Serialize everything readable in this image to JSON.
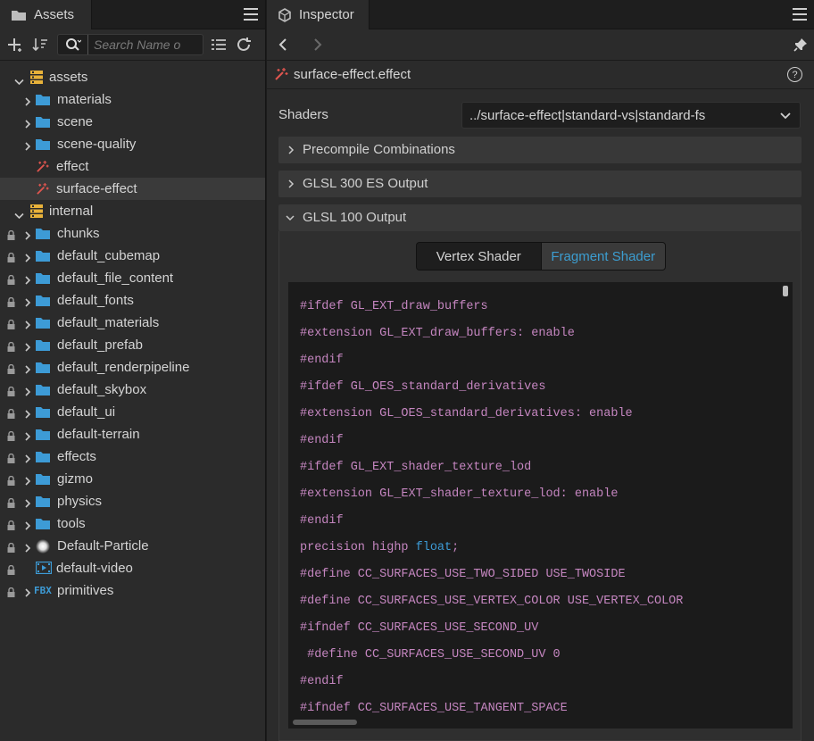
{
  "assets": {
    "tab_label": "Assets",
    "search_placeholder": "Search Name o",
    "tree": [
      {
        "label": "assets",
        "depth": 0,
        "expanded": true,
        "icon": "db-icon",
        "lock": false
      },
      {
        "label": "materials",
        "depth": 1,
        "expanded": false,
        "icon": "folder-icon",
        "lock": false
      },
      {
        "label": "scene",
        "depth": 1,
        "expanded": false,
        "icon": "folder-icon",
        "lock": false
      },
      {
        "label": "scene-quality",
        "depth": 1,
        "expanded": false,
        "icon": "folder-icon",
        "lock": false
      },
      {
        "label": "effect",
        "depth": 1,
        "expanded": null,
        "icon": "effect-icon",
        "lock": false
      },
      {
        "label": "surface-effect",
        "depth": 1,
        "expanded": null,
        "icon": "effect-icon",
        "lock": false,
        "selected": true
      },
      {
        "label": "internal",
        "depth": 0,
        "expanded": true,
        "icon": "db-icon",
        "lock": false
      },
      {
        "label": "chunks",
        "depth": 1,
        "expanded": false,
        "icon": "folder-icon",
        "lock": true
      },
      {
        "label": "default_cubemap",
        "depth": 1,
        "expanded": false,
        "icon": "folder-icon",
        "lock": true
      },
      {
        "label": "default_file_content",
        "depth": 1,
        "expanded": false,
        "icon": "folder-icon",
        "lock": true
      },
      {
        "label": "default_fonts",
        "depth": 1,
        "expanded": false,
        "icon": "folder-icon",
        "lock": true
      },
      {
        "label": "default_materials",
        "depth": 1,
        "expanded": false,
        "icon": "folder-icon",
        "lock": true
      },
      {
        "label": "default_prefab",
        "depth": 1,
        "expanded": false,
        "icon": "folder-icon",
        "lock": true
      },
      {
        "label": "default_renderpipeline",
        "depth": 1,
        "expanded": false,
        "icon": "folder-icon",
        "lock": true
      },
      {
        "label": "default_skybox",
        "depth": 1,
        "expanded": false,
        "icon": "folder-icon",
        "lock": true
      },
      {
        "label": "default_ui",
        "depth": 1,
        "expanded": false,
        "icon": "folder-icon",
        "lock": true
      },
      {
        "label": "default-terrain",
        "depth": 1,
        "expanded": false,
        "icon": "folder-icon",
        "lock": true
      },
      {
        "label": "effects",
        "depth": 1,
        "expanded": false,
        "icon": "folder-icon",
        "lock": true
      },
      {
        "label": "gizmo",
        "depth": 1,
        "expanded": false,
        "icon": "folder-icon",
        "lock": true
      },
      {
        "label": "physics",
        "depth": 1,
        "expanded": false,
        "icon": "folder-icon",
        "lock": true
      },
      {
        "label": "tools",
        "depth": 1,
        "expanded": false,
        "icon": "folder-icon",
        "lock": true
      },
      {
        "label": "Default-Particle",
        "depth": 1,
        "expanded": false,
        "icon": "particle-icon",
        "lock": true
      },
      {
        "label": "default-video",
        "depth": 1,
        "expanded": null,
        "icon": "video-icon",
        "lock": true
      },
      {
        "label": "primitives",
        "depth": 1,
        "expanded": false,
        "icon": "fbx-icon",
        "lock": true,
        "icon_text": "FBX"
      }
    ]
  },
  "inspector": {
    "tab_label": "Inspector",
    "file_title": "surface-effect.effect",
    "help_glyph": "?",
    "shaders_label": "Shaders",
    "shaders_value": "../surface-effect|standard-vs|standard-fs",
    "sections": [
      {
        "label": "Precompile Combinations",
        "expanded": false
      },
      {
        "label": "GLSL 300 ES Output",
        "expanded": false
      },
      {
        "label": "GLSL 100 Output",
        "expanded": true
      }
    ],
    "shader_tabs": {
      "vertex": "Vertex Shader",
      "fragment": "Fragment Shader",
      "active": "fragment"
    },
    "code_lines": [
      "#ifdef GL_EXT_draw_buffers",
      "#extension GL_EXT_draw_buffers: enable",
      "#endif",
      "#ifdef GL_OES_standard_derivatives",
      "#extension GL_OES_standard_derivatives: enable",
      "#endif",
      "#ifdef GL_EXT_shader_texture_lod",
      "#extension GL_EXT_shader_texture_lod: enable",
      "#endif",
      "precision highp float;",
      "#define CC_SURFACES_USE_TWO_SIDED USE_TWOSIDE",
      "#define CC_SURFACES_USE_VERTEX_COLOR USE_VERTEX_COLOR",
      "#ifndef CC_SURFACES_USE_SECOND_UV",
      " #define CC_SURFACES_USE_SECOND_UV 0",
      "#endif",
      "#ifndef CC_SURFACES_USE_TANGENT_SPACE"
    ]
  },
  "colors": {
    "folder": "#3d9bd6",
    "db": "#e8b23a",
    "accent": "#3c9dd0",
    "code": "#c586c0",
    "effect": "#e0554f"
  }
}
